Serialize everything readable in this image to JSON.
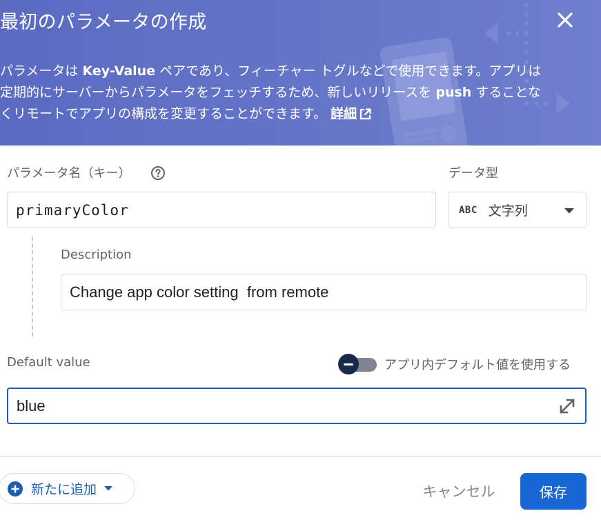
{
  "dialog": {
    "title": "最初のパラメータの作成",
    "description_pre": "パラメータは ",
    "description_key_value": "Key-Value",
    "description_mid": " ペアであり、フィーチャー トグルなどで使用できます。アプリは定期的にサーバーからパラメータをフェッチするため、新しいリリースを ",
    "description_push": "push",
    "description_post": " することなくリモートでアプリの構成を変更することができます。",
    "learn_more": "詳細"
  },
  "form": {
    "param_name_label": "パラメータ名（キー）",
    "param_name_value": "primaryColor",
    "data_type_label": "データ型",
    "data_type_abbr": "ABC",
    "data_type_value": "文字列",
    "description_label": "Description",
    "description_value": "Change app color setting  from remote",
    "default_value_label": "Default value",
    "default_value": "blue",
    "use_in_app_default_label": "アプリ内デフォルト値を使用する"
  },
  "footer": {
    "add_new_label": "新たに追加",
    "cancel_label": "キャンセル",
    "save_label": "保存"
  },
  "colors": {
    "header_bg": "#6170c4",
    "accent": "#1967d2",
    "focused_border": "#1a5fb4",
    "toggle_knob": "#172b4d"
  },
  "icons": [
    "close-icon",
    "external-link-icon",
    "help-icon",
    "abc-type-icon",
    "dropdown-caret-icon",
    "toggle-minus-icon",
    "expand-icon",
    "add-circle-icon"
  ]
}
